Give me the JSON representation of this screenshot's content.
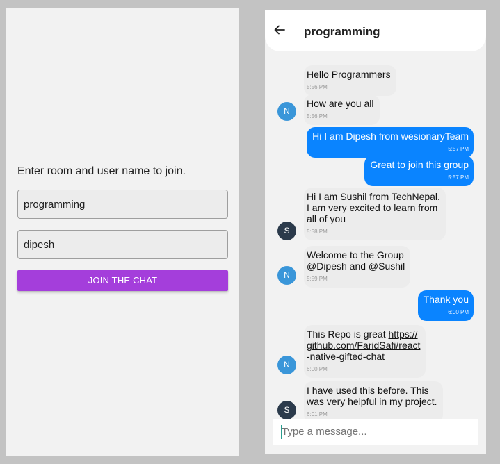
{
  "join": {
    "prompt": "Enter room and user name to join.",
    "room_value": "programming",
    "user_value": "dipesh",
    "button_label": "JOIN THE CHAT"
  },
  "chat": {
    "title": "programming",
    "composer_placeholder": "Type a message...",
    "colors": {
      "accent_purple": "#a43edb",
      "bubble_blue": "#0a84ff",
      "avatar_n": "#3a96d9",
      "avatar_s": "#2b3a4b"
    },
    "messages": [
      {
        "side": "left",
        "text": "Hello Programmers",
        "time": "5:56 PM"
      },
      {
        "side": "left",
        "text": "How are you all",
        "time": "5:56 PM",
        "avatar": "N"
      },
      {
        "side": "right",
        "text": "Hi I am Dipesh from wesionaryTeam",
        "time": "5:57 PM"
      },
      {
        "side": "right",
        "text": "Great to join this group",
        "time": "5:57 PM"
      },
      {
        "side": "left",
        "lines": [
          "Hi I am Sushil from TechNepal.",
          "I am very excited to learn from",
          "all of you"
        ],
        "time": "5:58 PM",
        "avatar": "S"
      },
      {
        "side": "left",
        "lines": [
          "Welcome to the Group",
          "@Dipesh and @Sushil"
        ],
        "time": "5:59 PM",
        "avatar": "N"
      },
      {
        "side": "right",
        "text": "Thank you",
        "time": "6:00 PM"
      },
      {
        "side": "left",
        "text_prefix": "This Repo is great ",
        "link_lines": [
          "https://",
          "github.com/FaridSafi/react",
          "-native-gifted-chat"
        ],
        "time": "6:00 PM",
        "avatar": "N"
      },
      {
        "side": "left",
        "lines": [
          "I have used this before. This",
          "was very helpful in my project."
        ],
        "time": "6:01 PM",
        "avatar": "S"
      }
    ]
  }
}
